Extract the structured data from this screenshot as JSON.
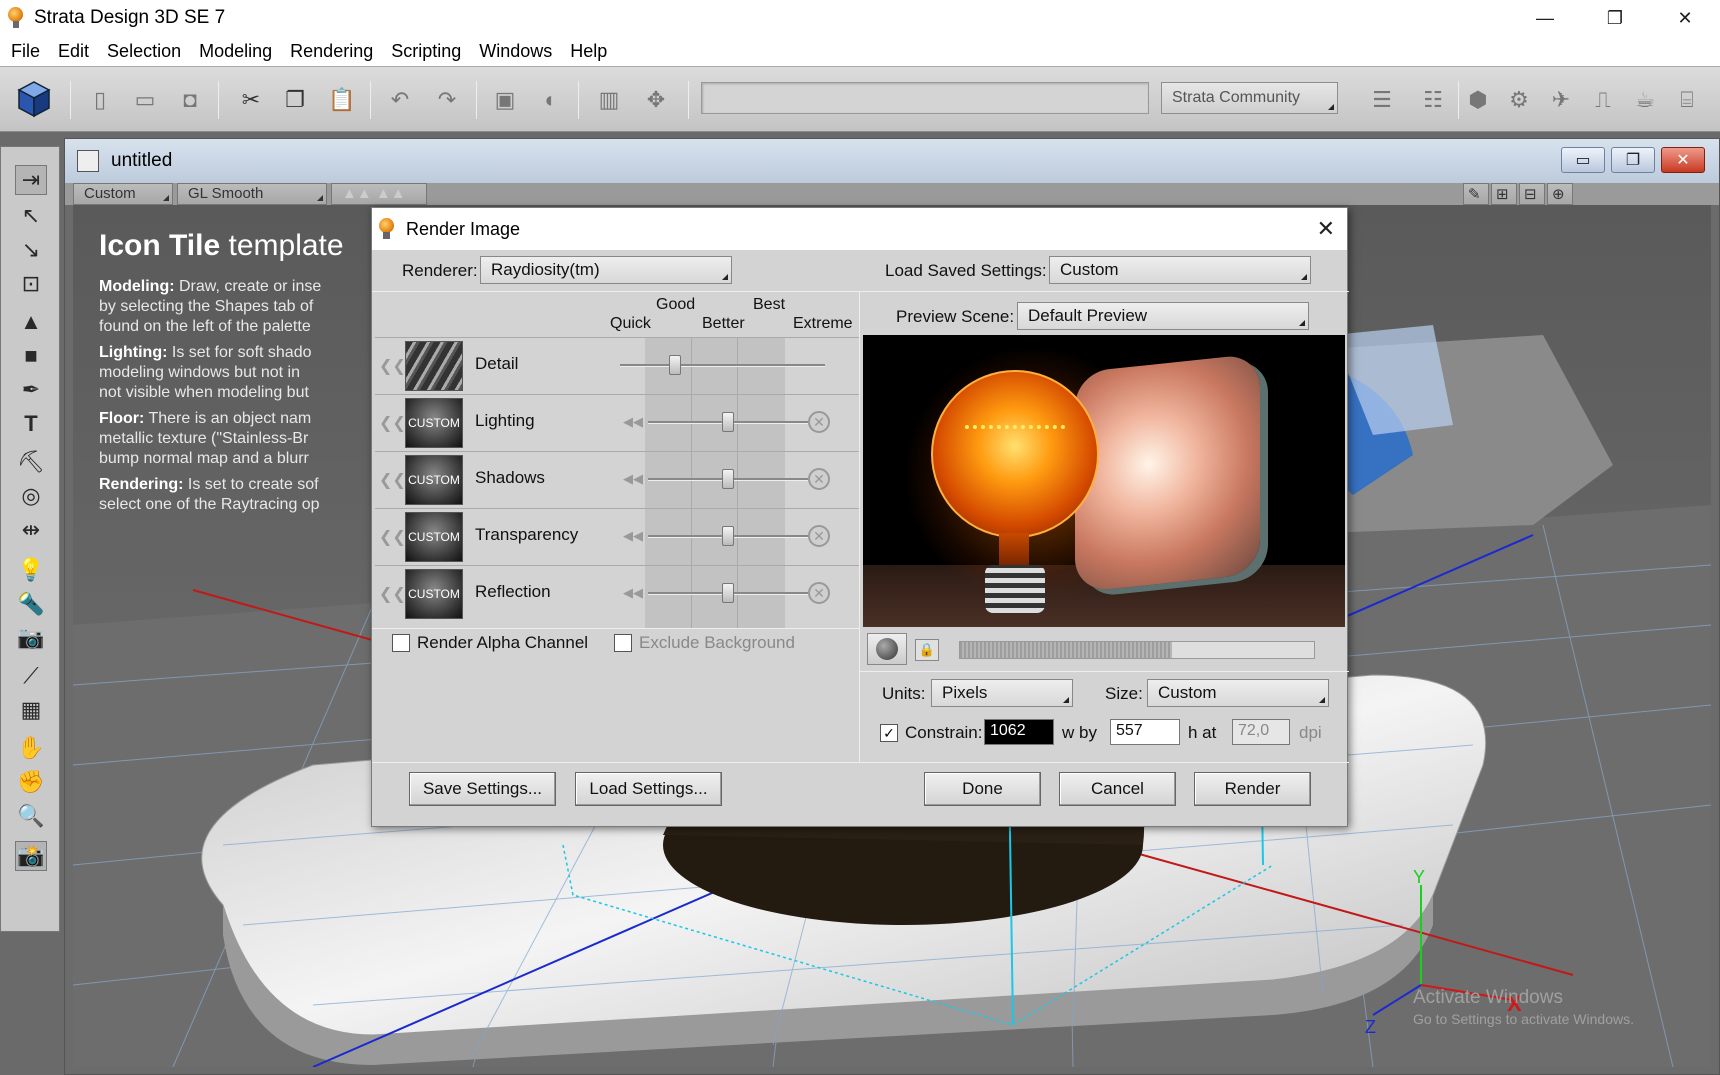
{
  "app": {
    "title": "Strata Design 3D SE 7",
    "window_controls": [
      "—",
      "❐",
      "✕"
    ]
  },
  "menu": [
    "File",
    "Edit",
    "Selection",
    "Modeling",
    "Rendering",
    "Scripting",
    "Windows",
    "Help"
  ],
  "toolbar": {
    "community_label": "Strata Community"
  },
  "document": {
    "title": "untitled",
    "view_dropdown": "Custom",
    "shading_dropdown": "GL Smooth",
    "controls": [
      "▭",
      "❐",
      "✕"
    ]
  },
  "viewport": {
    "heading_bold": "Icon Tile",
    "heading_normal": "template",
    "paragraphs": [
      {
        "label": "Modeling:",
        "lines": [
          " Draw, create or inse",
          "by selecting the Shapes tab of",
          "found on the left of the palette"
        ]
      },
      {
        "label": "Lighting:",
        "lines": [
          " Is set for soft shado",
          "modeling windows but not in",
          "not visible when modeling but"
        ]
      },
      {
        "label": "Floor:",
        "lines": [
          " There is an object nam",
          "metallic texture (\"Stainless-Br",
          "bump normal map and a blurr"
        ]
      },
      {
        "label": "Rendering:",
        "lines": [
          " Is set to create sof",
          "select one of the Raytracing op"
        ]
      }
    ],
    "watermark_title": "Activate Windows",
    "watermark_sub": "Go to Settings to activate Windows.",
    "axis_labels": {
      "y": "Y",
      "x": "X",
      "z": "Z"
    }
  },
  "dialog": {
    "title": "Render Image",
    "renderer_label": "Renderer:",
    "renderer_value": "Raydiosity(tm)",
    "load_saved_label": "Load Saved Settings:",
    "load_saved_value": "Custom",
    "quality_headers": {
      "quick": "Quick",
      "good": "Good",
      "better": "Better",
      "best": "Best",
      "extreme": "Extreme"
    },
    "quality_rows": [
      {
        "name": "Detail",
        "thumb": "",
        "level": 0.27
      },
      {
        "name": "Lighting",
        "thumb": "CUSTOM",
        "level": 0.5
      },
      {
        "name": "Shadows",
        "thumb": "CUSTOM",
        "level": 0.5
      },
      {
        "name": "Transparency",
        "thumb": "CUSTOM",
        "level": 0.5
      },
      {
        "name": "Reflection",
        "thumb": "CUSTOM",
        "level": 0.5
      }
    ],
    "render_alpha_label": "Render Alpha Channel",
    "exclude_bg_label": "Exclude Background",
    "preview_scene_label": "Preview Scene:",
    "preview_scene_value": "Default Preview",
    "preview_progress": 0.6,
    "units_label": "Units:",
    "units_value": "Pixels",
    "size_label": "Size:",
    "size_value": "Custom",
    "constrain_label": "Constrain:",
    "constrain_checked": "✓",
    "width_value": "1062",
    "w_by": "w  by",
    "height_value": "557",
    "h_at": "h  at",
    "dpi_value": "72,0",
    "dpi_label": "dpi",
    "buttons": {
      "save": "Save Settings...",
      "load": "Load Settings...",
      "done": "Done",
      "cancel": "Cancel",
      "render": "Render"
    }
  }
}
